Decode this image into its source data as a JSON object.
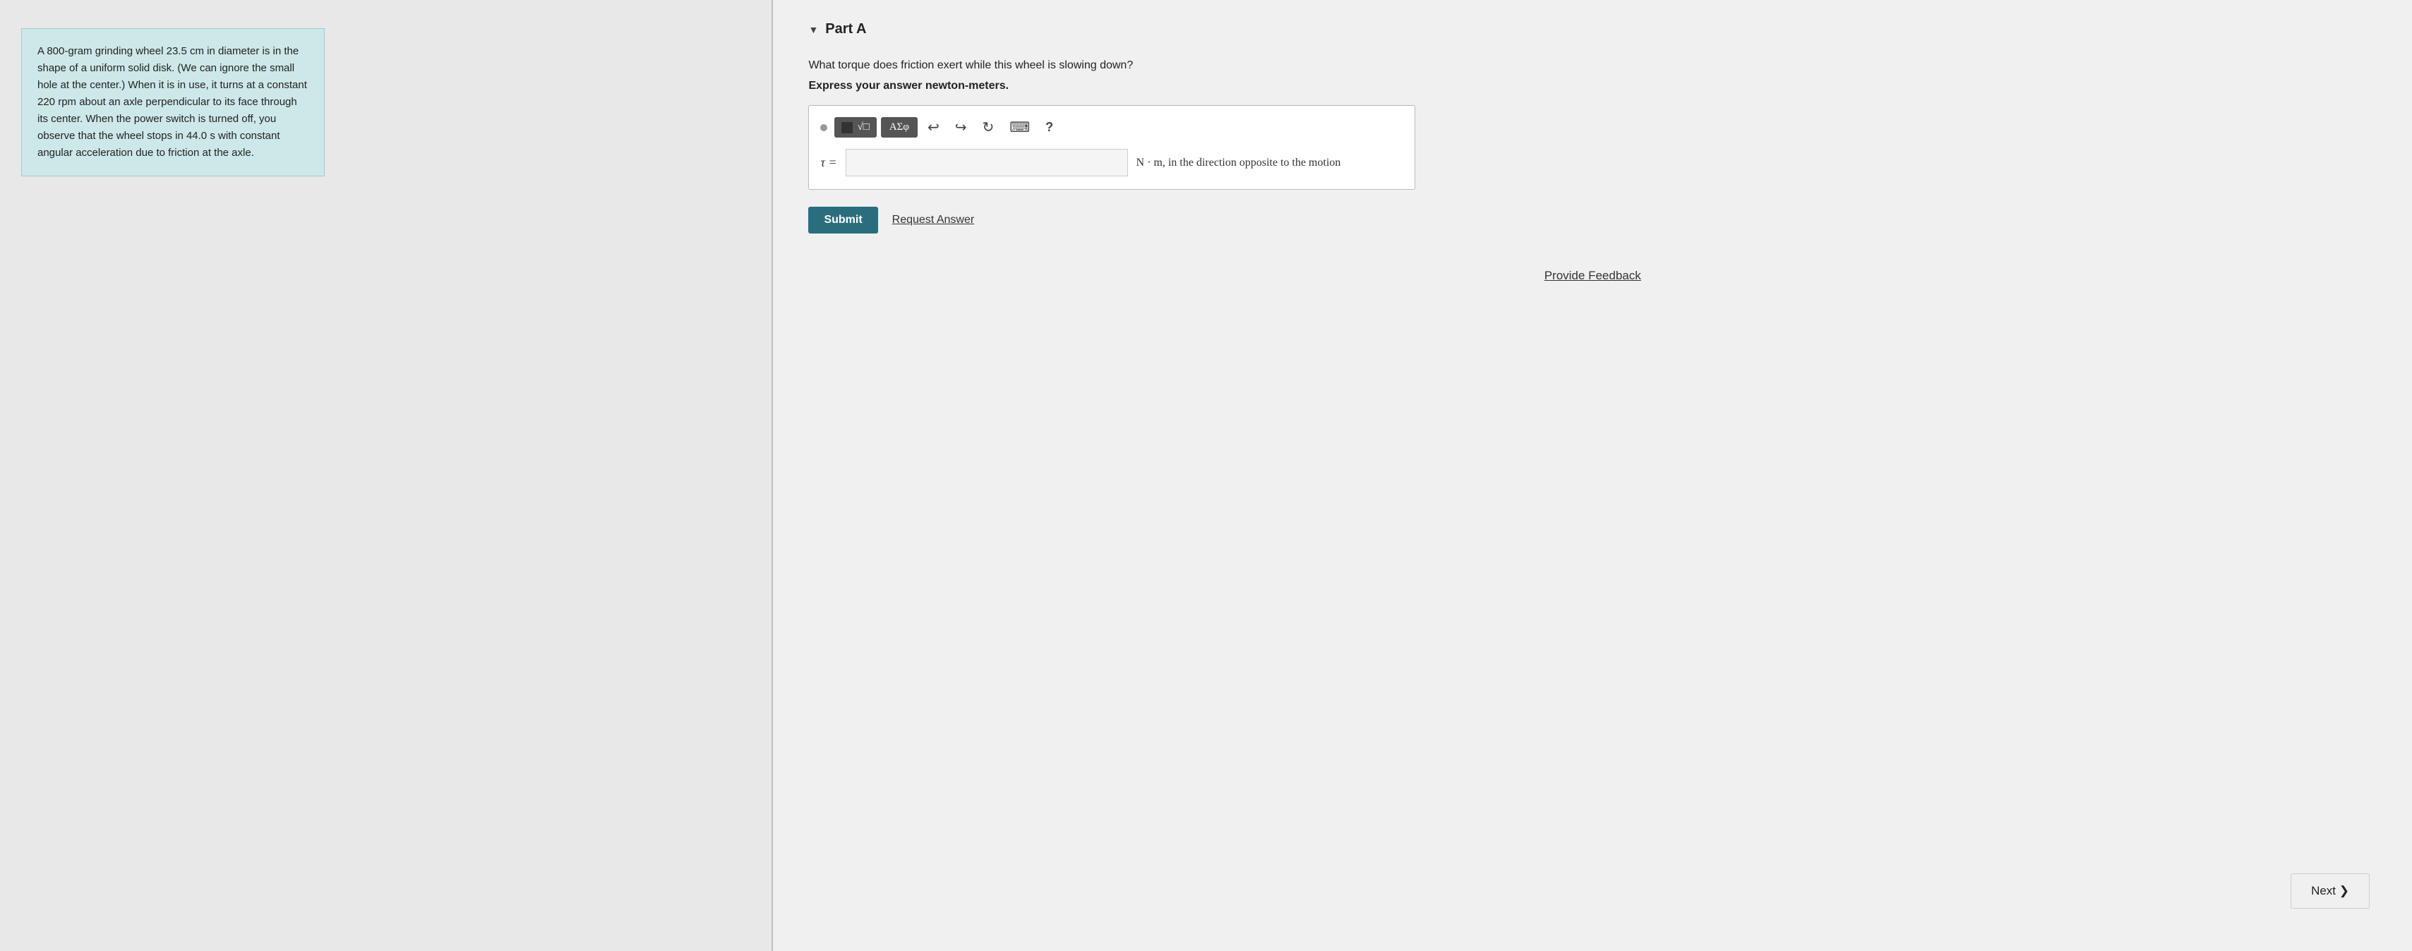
{
  "left": {
    "problem_text": "A 800-gram grinding wheel 23.5 cm in diameter is in the shape of a uniform solid disk. (We can ignore the small hole at the center.) When it is in use, it turns at a constant 220 rpm about an axle perpendicular to its face through its center. When the power switch is turned off, you observe that the wheel stops in 44.0 s with constant angular acceleration due to friction at the axle."
  },
  "right": {
    "part_label": "Part A",
    "question": "What torque does friction exert while this wheel is slowing down?",
    "instruction": "Express your answer newton-meters.",
    "toolbar": {
      "math_btn_label": "√□",
      "greek_btn_label": "ΑΣφ",
      "undo_icon": "↩",
      "redo_icon": "↪",
      "refresh_icon": "↻",
      "keyboard_icon": "⌨",
      "help_icon": "?"
    },
    "input": {
      "tau_label": "τ =",
      "placeholder": "",
      "unit": "N · m, in the direction opposite to the motion"
    },
    "submit_label": "Submit",
    "request_answer_label": "Request Answer",
    "provide_feedback_label": "Provide Feedback",
    "next_label": "Next ❯"
  }
}
